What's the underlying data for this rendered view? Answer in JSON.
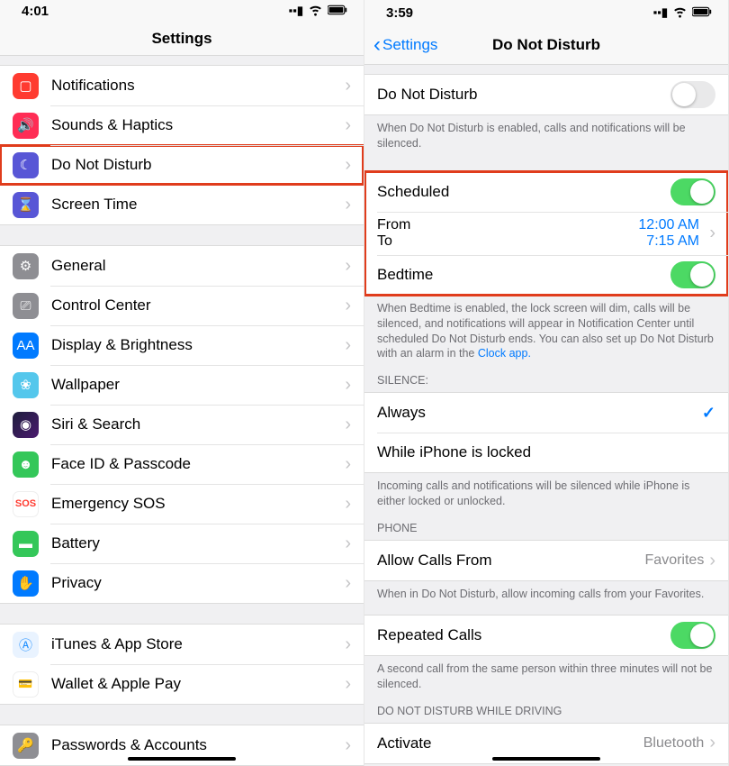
{
  "left": {
    "status_time": "4:01",
    "nav_title": "Settings",
    "groups": [
      {
        "items": [
          {
            "label": "Notifications",
            "icon": "notifications-icon",
            "icon_class": "ic-notif"
          },
          {
            "label": "Sounds & Haptics",
            "icon": "sounds-icon",
            "icon_class": "ic-sounds"
          },
          {
            "label": "Do Not Disturb",
            "icon": "moon-icon",
            "icon_class": "ic-dnd",
            "highlight": true
          },
          {
            "label": "Screen Time",
            "icon": "hourglass-icon",
            "icon_class": "ic-screen"
          }
        ]
      },
      {
        "items": [
          {
            "label": "General",
            "icon": "gear-icon",
            "icon_class": "ic-gen"
          },
          {
            "label": "Control Center",
            "icon": "switches-icon",
            "icon_class": "ic-cc"
          },
          {
            "label": "Display & Brightness",
            "icon": "text-size-icon",
            "icon_class": "ic-disp"
          },
          {
            "label": "Wallpaper",
            "icon": "flower-icon",
            "icon_class": "ic-wall"
          },
          {
            "label": "Siri & Search",
            "icon": "siri-icon",
            "icon_class": "ic-siri"
          },
          {
            "label": "Face ID & Passcode",
            "icon": "face-icon",
            "icon_class": "ic-face"
          },
          {
            "label": "Emergency SOS",
            "icon": "sos-icon",
            "icon_class": "ic-sos",
            "icon_text": "SOS"
          },
          {
            "label": "Battery",
            "icon": "battery-icon",
            "icon_class": "ic-bat"
          },
          {
            "label": "Privacy",
            "icon": "hand-icon",
            "icon_class": "ic-priv"
          }
        ]
      },
      {
        "items": [
          {
            "label": "iTunes & App Store",
            "icon": "appstore-icon",
            "icon_class": "ic-itunes"
          },
          {
            "label": "Wallet & Apple Pay",
            "icon": "wallet-icon",
            "icon_class": "ic-wallet"
          }
        ]
      },
      {
        "items": [
          {
            "label": "Passwords & Accounts",
            "icon": "key-icon",
            "icon_class": "ic-gen"
          }
        ]
      }
    ]
  },
  "right": {
    "status_time": "3:59",
    "back_label": "Settings",
    "nav_title": "Do Not Disturb",
    "dnd": {
      "label": "Do Not Disturb",
      "on": false
    },
    "dnd_footer": "When Do Not Disturb is enabled, calls and notifications will be silenced.",
    "scheduled": {
      "label": "Scheduled",
      "on": true
    },
    "from_label": "From",
    "to_label": "To",
    "from_time": "12:00 AM",
    "to_time": "7:15 AM",
    "bedtime": {
      "label": "Bedtime",
      "on": true
    },
    "bedtime_footer": "When Bedtime is enabled, the lock screen will dim, calls will be silenced, and notifications will appear in Notification Center until scheduled Do Not Disturb ends. You can also set up Do Not Disturb with an alarm in the ",
    "bedtime_link": "Clock app.",
    "silence_header": "SILENCE:",
    "silence_always": "Always",
    "silence_locked": "While iPhone is locked",
    "silence_footer": "Incoming calls and notifications will be silenced while iPhone is either locked or unlocked.",
    "phone_header": "PHONE",
    "allow_label": "Allow Calls From",
    "allow_value": "Favorites",
    "allow_footer": "When in Do Not Disturb, allow incoming calls from your Favorites.",
    "repeated": {
      "label": "Repeated Calls",
      "on": true
    },
    "repeated_footer": "A second call from the same person within three minutes will not be silenced.",
    "driving_header": "DO NOT DISTURB WHILE DRIVING",
    "activate_label": "Activate",
    "activate_value": "Bluetooth"
  }
}
